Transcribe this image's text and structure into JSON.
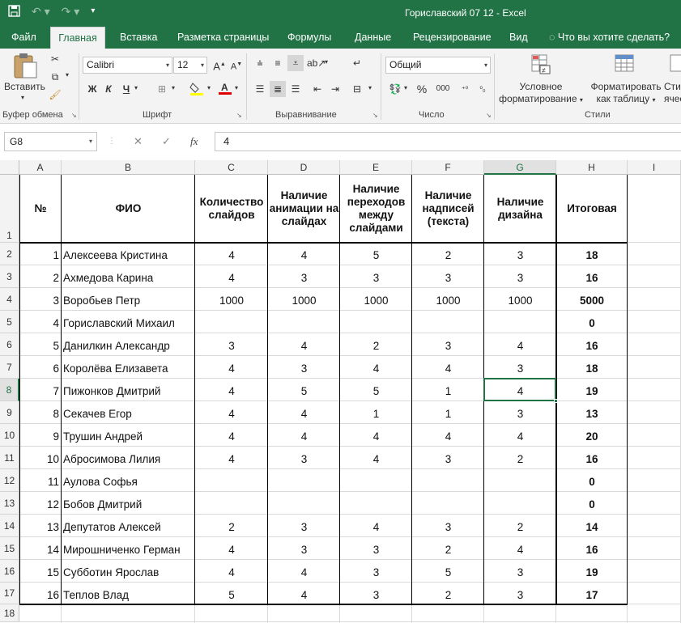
{
  "window": {
    "title": "Гориславский 07 12 - Excel"
  },
  "tabs": [
    "Файл",
    "Главная",
    "Вставка",
    "Разметка страницы",
    "Формулы",
    "Данные",
    "Рецензирование",
    "Вид"
  ],
  "tell_me": "Что вы хотите сделать?",
  "ribbon": {
    "paste_label": "Вставить",
    "clipboard_label": "Буфер обмена",
    "font_name": "Calibri",
    "font_size": "12",
    "font_label": "Шрифт",
    "bold": "Ж",
    "italic": "К",
    "underline": "Ч",
    "alignment_label": "Выравнивание",
    "number_format": "Общий",
    "number_label": "Число",
    "percent": "%",
    "thousands": "000",
    "cond_format_l1": "Условное",
    "cond_format_l2": "форматирование",
    "format_table_l1": "Форматировать",
    "format_table_l2": "как таблицу",
    "cell_styles_l1": "Сти",
    "cell_styles_l2": "ячее",
    "styles_label": "Стили"
  },
  "formula_bar": {
    "cell_ref": "G8",
    "value": "4",
    "fx": "fx"
  },
  "columns": [
    "A",
    "B",
    "C",
    "D",
    "E",
    "F",
    "G",
    "H",
    "I"
  ],
  "selected_column": "G",
  "selected_row": 8,
  "header_row": {
    "a": "№",
    "b": "ФИО",
    "c": "Количество слайдов",
    "d": "Наличие анимации на слайдах",
    "e": "Наличие переходов между слайдами",
    "f": "Наличие надписей (текста)",
    "g": "Наличие дизайна",
    "h": "Итоговая"
  },
  "rows": [
    {
      "n": "1",
      "name": "Алексеева Кристина",
      "c": "4",
      "d": "4",
      "e": "5",
      "f": "2",
      "g": "3",
      "h": "18"
    },
    {
      "n": "2",
      "name": "Ахмедова Карина",
      "c": "4",
      "d": "3",
      "e": "3",
      "f": "3",
      "g": "3",
      "h": "16"
    },
    {
      "n": "3",
      "name": "Воробьев Петр",
      "c": "1000",
      "d": "1000",
      "e": "1000",
      "f": "1000",
      "g": "1000",
      "h": "5000"
    },
    {
      "n": "4",
      "name": "Гориславский Михаил",
      "c": "",
      "d": "",
      "e": "",
      "f": "",
      "g": "",
      "h": "0"
    },
    {
      "n": "5",
      "name": "Данилкин Александр",
      "c": "3",
      "d": "4",
      "e": "2",
      "f": "3",
      "g": "4",
      "h": "16"
    },
    {
      "n": "6",
      "name": "Королёва Елизавета",
      "c": "4",
      "d": "3",
      "e": "4",
      "f": "4",
      "g": "3",
      "h": "18"
    },
    {
      "n": "7",
      "name": "Пижонков Дмитрий",
      "c": "4",
      "d": "5",
      "e": "5",
      "f": "1",
      "g": "4",
      "h": "19"
    },
    {
      "n": "8",
      "name": "Секачев Егор",
      "c": "4",
      "d": "4",
      "e": "1",
      "f": "1",
      "g": "3",
      "h": "13"
    },
    {
      "n": "9",
      "name": "Трушин Андрей",
      "c": "4",
      "d": "4",
      "e": "4",
      "f": "4",
      "g": "4",
      "h": "20"
    },
    {
      "n": "10",
      "name": "Абросимова Лилия",
      "c": "4",
      "d": "3",
      "e": "4",
      "f": "3",
      "g": "2",
      "h": "16"
    },
    {
      "n": "11",
      "name": "Аулова Софья",
      "c": "",
      "d": "",
      "e": "",
      "f": "",
      "g": "",
      "h": "0"
    },
    {
      "n": "12",
      "name": "Бобов Дмитрий",
      "c": "",
      "d": "",
      "e": "",
      "f": "",
      "g": "",
      "h": "0"
    },
    {
      "n": "13",
      "name": "Депутатов Алексей",
      "c": "2",
      "d": "3",
      "e": "4",
      "f": "3",
      "g": "2",
      "h": "14"
    },
    {
      "n": "14",
      "name": "Мирошниченко Герман",
      "c": "4",
      "d": "3",
      "e": "3",
      "f": "2",
      "g": "4",
      "h": "16"
    },
    {
      "n": "15",
      "name": "Субботин Ярослав",
      "c": "4",
      "d": "4",
      "e": "3",
      "f": "5",
      "g": "3",
      "h": "19"
    },
    {
      "n": "16",
      "name": "Теплов Влад",
      "c": "5",
      "d": "4",
      "e": "3",
      "f": "2",
      "g": "3",
      "h": "17"
    }
  ]
}
